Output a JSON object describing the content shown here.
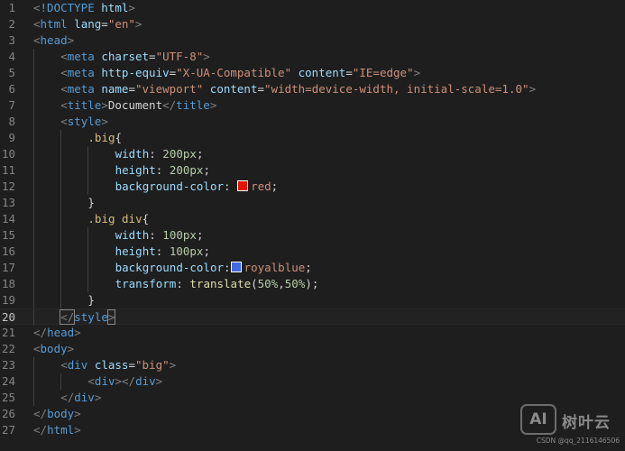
{
  "editor": {
    "current_line": 20,
    "lines": [
      {
        "n": "1",
        "indent": 0,
        "tokens": [
          [
            "punc",
            "<"
          ],
          [
            "tag",
            "!DOCTYPE"
          ],
          [
            "text",
            " "
          ],
          [
            "attr",
            "html"
          ],
          [
            "punc",
            ">"
          ]
        ]
      },
      {
        "n": "2",
        "indent": 0,
        "tokens": [
          [
            "punc",
            "<"
          ],
          [
            "tag",
            "html"
          ],
          [
            "text",
            " "
          ],
          [
            "attr",
            "lang"
          ],
          [
            "text",
            "="
          ],
          [
            "str",
            "\"en\""
          ],
          [
            "punc",
            ">"
          ]
        ]
      },
      {
        "n": "3",
        "indent": 0,
        "tokens": [
          [
            "punc",
            "<"
          ],
          [
            "tag",
            "head"
          ],
          [
            "punc",
            ">"
          ]
        ]
      },
      {
        "n": "4",
        "indent": 1,
        "tokens": [
          [
            "punc",
            "<"
          ],
          [
            "tag",
            "meta"
          ],
          [
            "text",
            " "
          ],
          [
            "attr",
            "charset"
          ],
          [
            "text",
            "="
          ],
          [
            "str",
            "\"UTF-8\""
          ],
          [
            "punc",
            ">"
          ]
        ]
      },
      {
        "n": "5",
        "indent": 1,
        "tokens": [
          [
            "punc",
            "<"
          ],
          [
            "tag",
            "meta"
          ],
          [
            "text",
            " "
          ],
          [
            "attr",
            "http-equiv"
          ],
          [
            "text",
            "="
          ],
          [
            "str",
            "\"X-UA-Compatible\""
          ],
          [
            "text",
            " "
          ],
          [
            "attr",
            "content"
          ],
          [
            "text",
            "="
          ],
          [
            "str",
            "\"IE=edge\""
          ],
          [
            "punc",
            ">"
          ]
        ]
      },
      {
        "n": "6",
        "indent": 1,
        "tokens": [
          [
            "punc",
            "<"
          ],
          [
            "tag",
            "meta"
          ],
          [
            "text",
            " "
          ],
          [
            "attr",
            "name"
          ],
          [
            "text",
            "="
          ],
          [
            "str",
            "\"viewport\""
          ],
          [
            "text",
            " "
          ],
          [
            "attr",
            "content"
          ],
          [
            "text",
            "="
          ],
          [
            "str",
            "\"width=device-width, initial-scale=1.0\""
          ],
          [
            "punc",
            ">"
          ]
        ]
      },
      {
        "n": "7",
        "indent": 1,
        "tokens": [
          [
            "punc",
            "<"
          ],
          [
            "tag",
            "title"
          ],
          [
            "punc",
            ">"
          ],
          [
            "text",
            "Document"
          ],
          [
            "punc",
            "</"
          ],
          [
            "tag",
            "title"
          ],
          [
            "punc",
            ">"
          ]
        ]
      },
      {
        "n": "8",
        "indent": 1,
        "tokens": [
          [
            "punc",
            "<"
          ],
          [
            "tag",
            "style"
          ],
          [
            "punc",
            ">"
          ]
        ]
      },
      {
        "n": "9",
        "indent": 2,
        "tokens": [
          [
            "sel",
            ".big"
          ],
          [
            "text",
            "{"
          ]
        ]
      },
      {
        "n": "10",
        "indent": 3,
        "tokens": [
          [
            "prop",
            "width"
          ],
          [
            "text",
            ": "
          ],
          [
            "num",
            "200px"
          ],
          [
            "text",
            ";"
          ]
        ]
      },
      {
        "n": "11",
        "indent": 3,
        "tokens": [
          [
            "prop",
            "height"
          ],
          [
            "text",
            ": "
          ],
          [
            "num",
            "200px"
          ],
          [
            "text",
            ";"
          ]
        ]
      },
      {
        "n": "12",
        "indent": 3,
        "tokens": [
          [
            "prop",
            "background-color"
          ],
          [
            "text",
            ": "
          ],
          [
            "swatch",
            "#e51400"
          ],
          [
            "val",
            "red"
          ],
          [
            "text",
            ";"
          ]
        ]
      },
      {
        "n": "13",
        "indent": 2,
        "tokens": [
          [
            "text",
            "}"
          ]
        ]
      },
      {
        "n": "14",
        "indent": 2,
        "tokens": [
          [
            "sel",
            ".big div"
          ],
          [
            "text",
            "{"
          ]
        ]
      },
      {
        "n": "15",
        "indent": 3,
        "tokens": [
          [
            "prop",
            "width"
          ],
          [
            "text",
            ": "
          ],
          [
            "num",
            "100px"
          ],
          [
            "text",
            ";"
          ]
        ]
      },
      {
        "n": "16",
        "indent": 3,
        "tokens": [
          [
            "prop",
            "height"
          ],
          [
            "text",
            ": "
          ],
          [
            "num",
            "100px"
          ],
          [
            "text",
            ";"
          ]
        ]
      },
      {
        "n": "17",
        "indent": 3,
        "tokens": [
          [
            "prop",
            "background-color"
          ],
          [
            "text",
            ":"
          ],
          [
            "swatch",
            "#4169e1"
          ],
          [
            "val",
            "royalblue"
          ],
          [
            "text",
            ";"
          ]
        ]
      },
      {
        "n": "18",
        "indent": 3,
        "tokens": [
          [
            "prop",
            "transform"
          ],
          [
            "text",
            ": "
          ],
          [
            "fn",
            "translate"
          ],
          [
            "text",
            "("
          ],
          [
            "num",
            "50%"
          ],
          [
            "text",
            ","
          ],
          [
            "num",
            "50%"
          ],
          [
            "text",
            ");"
          ]
        ]
      },
      {
        "n": "19",
        "indent": 2,
        "tokens": [
          [
            "text",
            "}"
          ]
        ]
      },
      {
        "n": "20",
        "indent": 1,
        "tokens": [
          [
            "punc",
            "</"
          ],
          [
            "tag",
            "style"
          ],
          [
            "punc",
            ">"
          ]
        ]
      },
      {
        "n": "21",
        "indent": 0,
        "tokens": [
          [
            "punc",
            "</"
          ],
          [
            "tag",
            "head"
          ],
          [
            "punc",
            ">"
          ]
        ]
      },
      {
        "n": "22",
        "indent": 0,
        "tokens": [
          [
            "punc",
            "<"
          ],
          [
            "tag",
            "body"
          ],
          [
            "punc",
            ">"
          ]
        ]
      },
      {
        "n": "23",
        "indent": 1,
        "tokens": [
          [
            "punc",
            "<"
          ],
          [
            "tag",
            "div"
          ],
          [
            "text",
            " "
          ],
          [
            "attr",
            "class"
          ],
          [
            "text",
            "="
          ],
          [
            "str",
            "\"big\""
          ],
          [
            "punc",
            ">"
          ]
        ]
      },
      {
        "n": "24",
        "indent": 2,
        "tokens": [
          [
            "punc",
            "<"
          ],
          [
            "tag",
            "div"
          ],
          [
            "punc",
            "></"
          ],
          [
            "tag",
            "div"
          ],
          [
            "punc",
            ">"
          ]
        ]
      },
      {
        "n": "25",
        "indent": 1,
        "tokens": [
          [
            "punc",
            "</"
          ],
          [
            "tag",
            "div"
          ],
          [
            "punc",
            ">"
          ]
        ]
      },
      {
        "n": "26",
        "indent": 0,
        "tokens": [
          [
            "punc",
            "</"
          ],
          [
            "tag",
            "body"
          ],
          [
            "punc",
            ">"
          ]
        ]
      },
      {
        "n": "27",
        "indent": 0,
        "tokens": [
          [
            "punc",
            "</"
          ],
          [
            "tag",
            "html"
          ],
          [
            "punc",
            ">"
          ]
        ]
      }
    ]
  },
  "watermark": {
    "logo_text": "AI",
    "brand": "树叶云",
    "credit": "CSDN @qq_2116146506"
  }
}
